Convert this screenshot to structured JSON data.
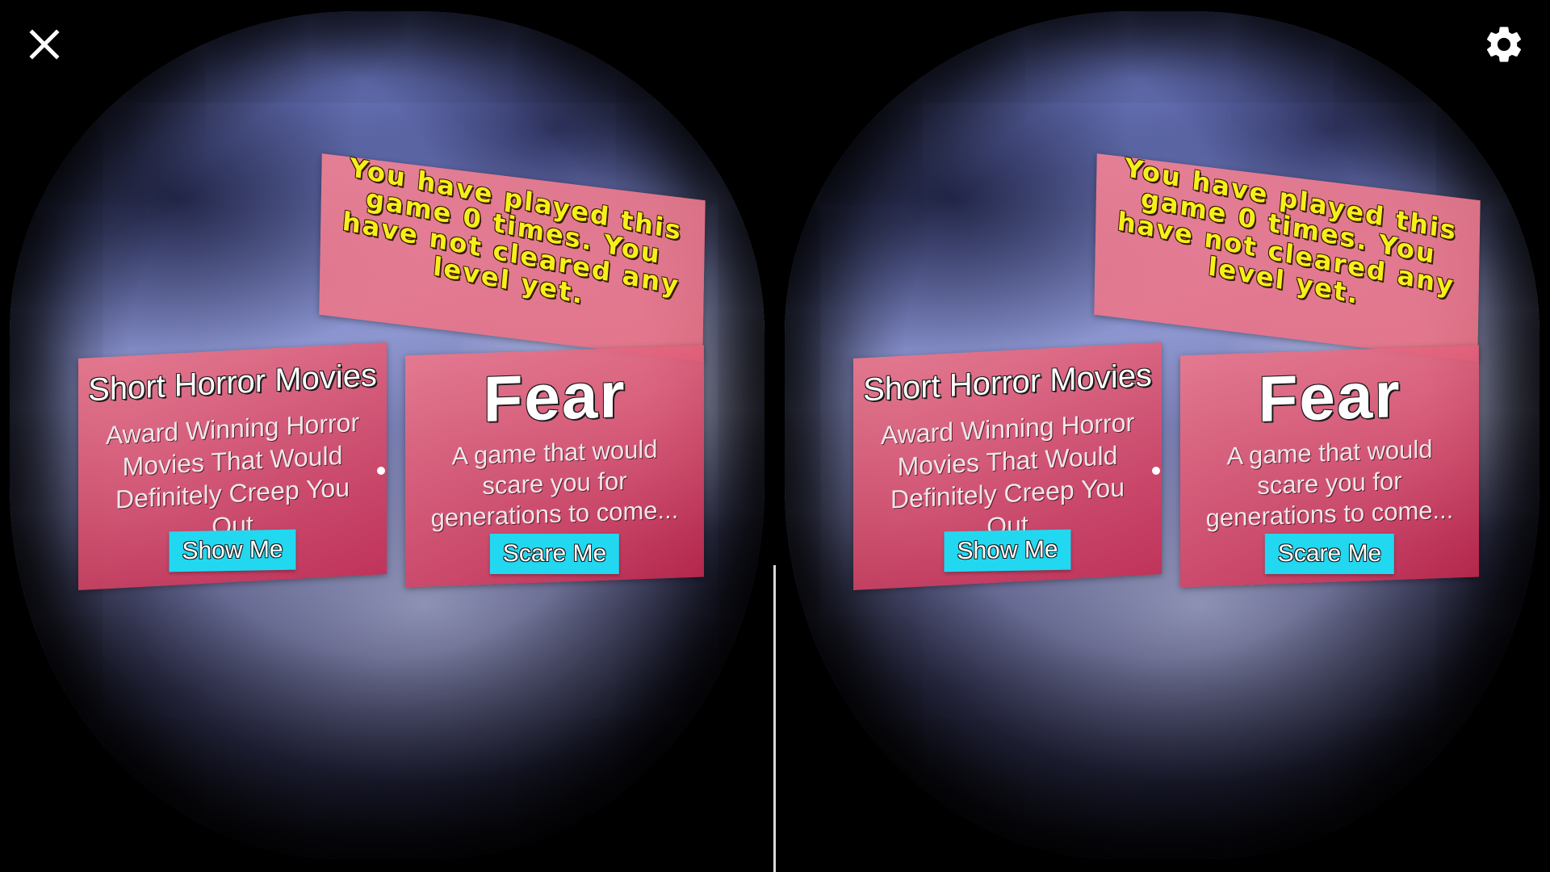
{
  "toolbar": {
    "close_icon": "close-icon",
    "settings_icon": "gear-icon"
  },
  "stats": {
    "text": "You have played this game 0 times. You have not cleared any level yet."
  },
  "movies": {
    "title": "Short Horror Movies",
    "description": "Award Winning Horror Movies That Would Definitely Creep You Out",
    "button_label": "Show Me"
  },
  "fear": {
    "title": "Fear",
    "description": "A game that would scare you for generations to come...",
    "button_label": "Scare Me"
  },
  "colors": {
    "panel": "#d94b6e",
    "button": "#22d8f0",
    "stats_text": "#f5f01a",
    "background": "#000000"
  }
}
